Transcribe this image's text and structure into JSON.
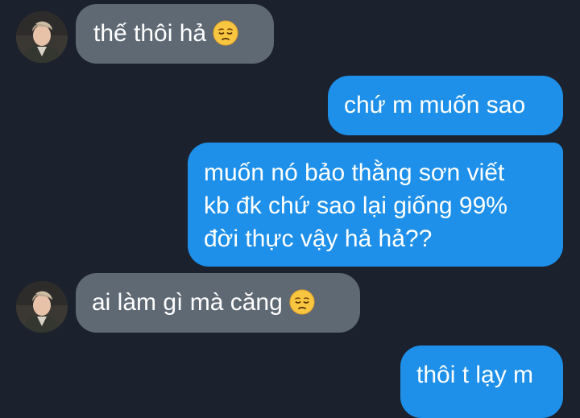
{
  "messages": [
    {
      "sender": "other",
      "text": "thế thôi hả",
      "emoji": "pensive-face"
    },
    {
      "sender": "me",
      "text": "chứ m muốn sao"
    },
    {
      "sender": "me",
      "lines": [
        "muốn nó bảo thằng sơn viết",
        "kb đk chứ sao lại giống 99%",
        "đời thực vậy hả hả??"
      ]
    },
    {
      "sender": "other",
      "text": "ai làm gì mà căng",
      "emoji": "pensive-face"
    },
    {
      "sender": "me",
      "text": "thôi t lạy m"
    }
  ],
  "colors": {
    "background": "#1b212d",
    "incoming_bubble": "#5f6974",
    "outgoing_bubble": "#1e90ea",
    "text": "#ffffff"
  }
}
